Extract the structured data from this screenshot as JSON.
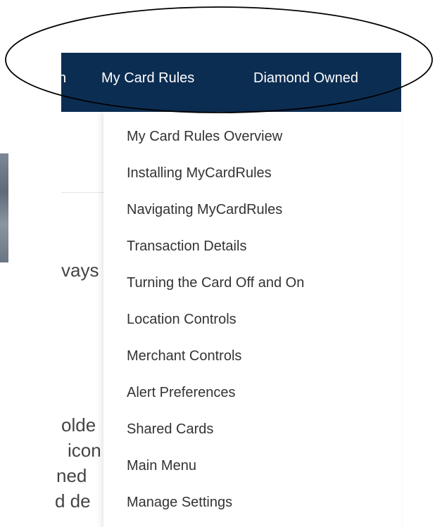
{
  "nav": {
    "partial_label": "n",
    "items": [
      {
        "label": "My Card Rules"
      },
      {
        "label": "Diamond Owned"
      }
    ]
  },
  "background": {
    "fragments": [
      "vays",
      "olde",
      "icon",
      "ned",
      "d de"
    ]
  },
  "dropdown": {
    "items": [
      {
        "label": "My Card Rules Overview"
      },
      {
        "label": "Installing MyCardRules"
      },
      {
        "label": "Navigating MyCardRules"
      },
      {
        "label": "Transaction Details"
      },
      {
        "label": "Turning the Card Off and On"
      },
      {
        "label": "Location Controls"
      },
      {
        "label": "Merchant Controls"
      },
      {
        "label": "Alert Preferences"
      },
      {
        "label": "Shared Cards"
      },
      {
        "label": "Main Menu"
      },
      {
        "label": "Manage Settings"
      }
    ]
  },
  "colors": {
    "navbar": "#0c2d52",
    "nav_text": "#ffffff",
    "menu_text": "#333333",
    "annotation_stroke": "#000000"
  }
}
